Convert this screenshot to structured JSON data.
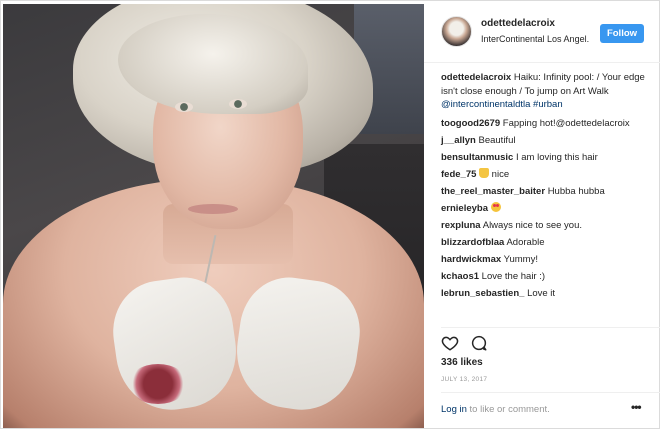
{
  "header": {
    "username": "odettedelacroix",
    "location": "InterContinental Los Angel...",
    "follow_label": "Follow"
  },
  "caption": {
    "username": "odettedelacroix",
    "text": "Haiku: Infinity pool: / Your edge isn't close enough / To jump on Art Walk",
    "mention": "@intercontinentaldtla",
    "hashtag": "#urban"
  },
  "comments": [
    {
      "user": "toogood2679",
      "text": "Fapping hot!@odettedelacroix"
    },
    {
      "user": "j__allyn",
      "text": "Beautiful"
    },
    {
      "user": "bensultanmusic",
      "text": "I am loving this hair"
    },
    {
      "user": "fede_75",
      "text": "nice",
      "emoji": "thumbs-up"
    },
    {
      "user": "the_reel_master_baiter",
      "text": "Hubba hubba"
    },
    {
      "user": "ernieleyba",
      "text": "",
      "emoji": "heart-eyes"
    },
    {
      "user": "rexpluna",
      "text": "Always nice to see you."
    },
    {
      "user": "blizzardofblaa",
      "text": "Adorable"
    },
    {
      "user": "hardwickmax",
      "text": "Yummy!"
    },
    {
      "user": "kchaos1",
      "text": "Love the hair :)"
    },
    {
      "user": "lebrun_sebastien_",
      "text": "Love it"
    }
  ],
  "actions": {
    "like_icon": "heart-outline-icon",
    "comment_icon": "comment-bubble-icon"
  },
  "likes": "336 likes",
  "date": "JULY 13, 2017",
  "footer": {
    "login_label": "Log in",
    "login_suffix": " to like or comment.",
    "more_label": "•••"
  },
  "colors": {
    "follow_bg": "#3897f0",
    "link": "#003569",
    "muted": "#999999"
  }
}
